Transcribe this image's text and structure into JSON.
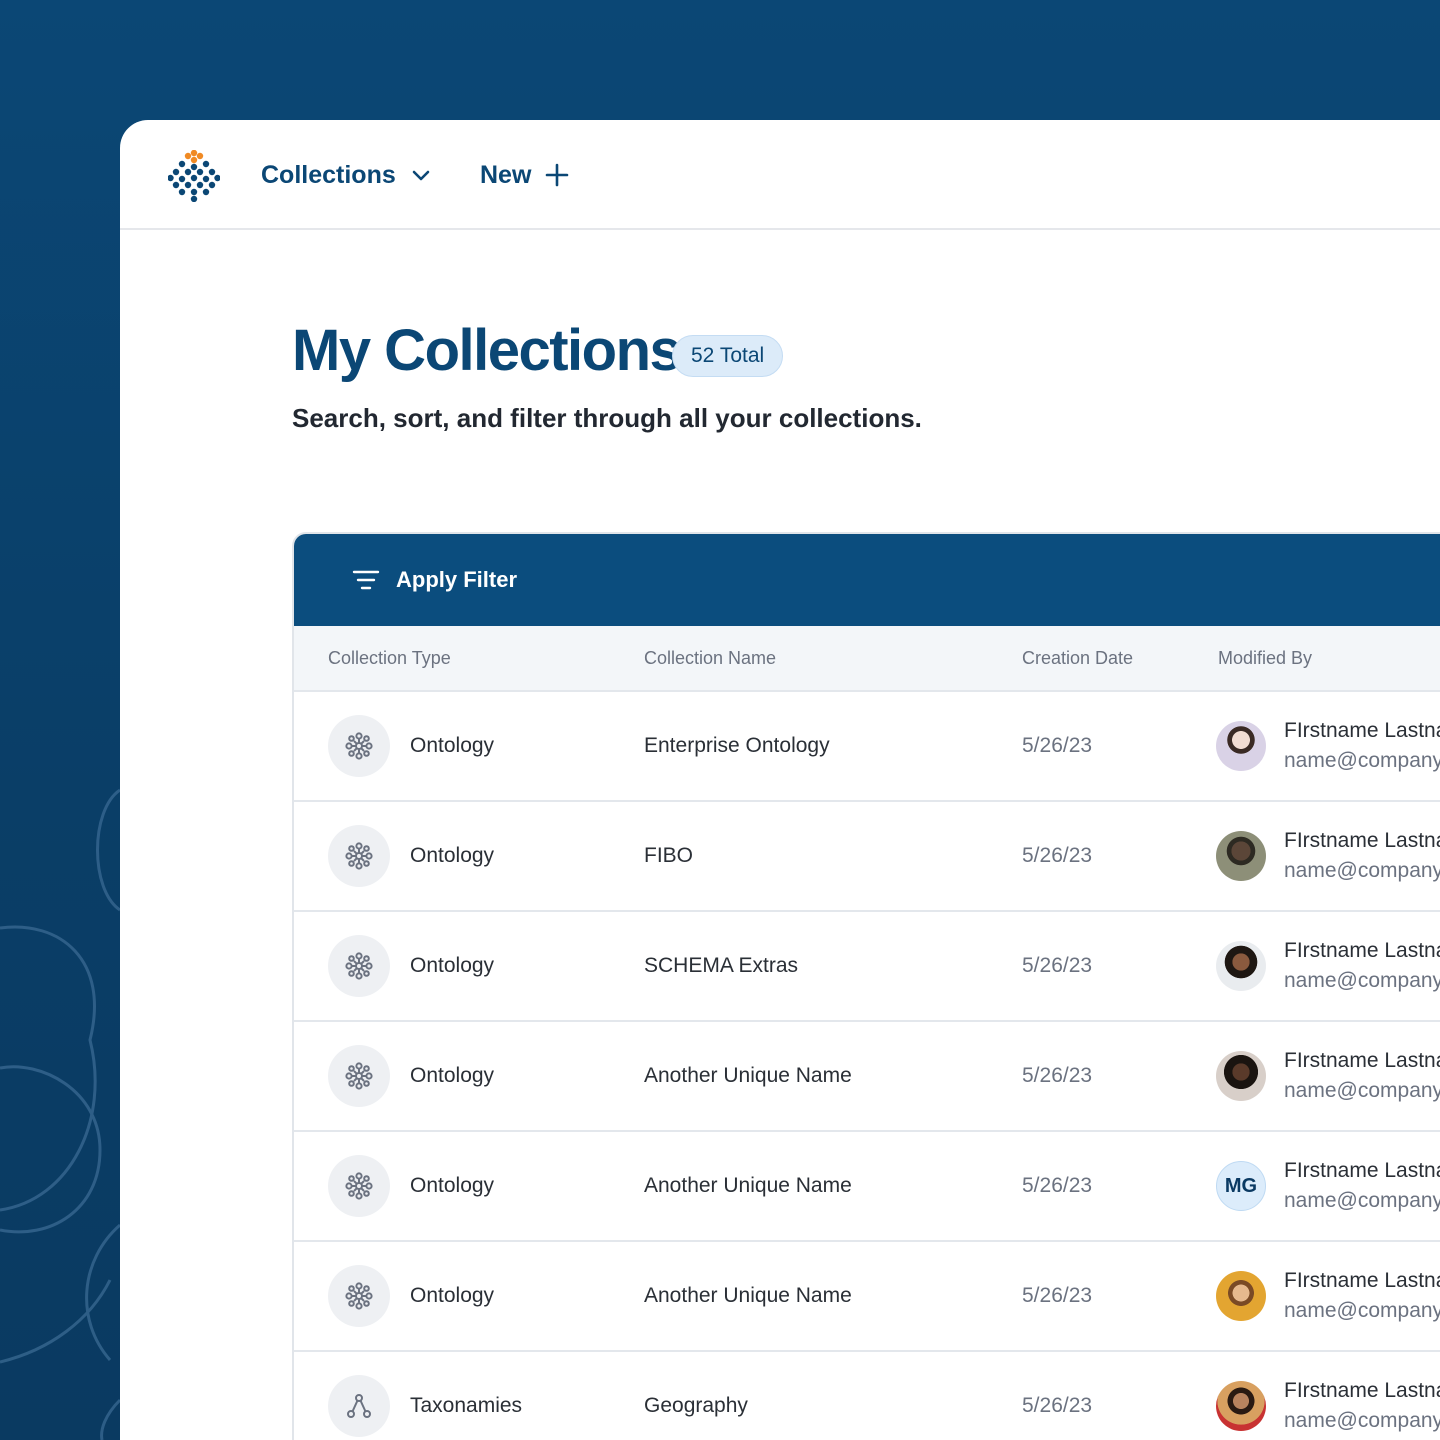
{
  "nav": {
    "collections_label": "Collections",
    "new_label": "New"
  },
  "header": {
    "title": "My Collections",
    "total_badge": "52 Total",
    "subtitle": "Search, sort, and filter through all your collections."
  },
  "toolbar": {
    "filter_label": "Apply Filter"
  },
  "table": {
    "columns": [
      "Collection Type",
      "Collection Name",
      "Creation Date",
      "Modified By"
    ],
    "rows": [
      {
        "type": "Ontology",
        "type_icon": "network-node-icon",
        "name": "Enterprise Ontology",
        "date": "5/26/23",
        "modified_name": "FIrstname Lastname",
        "modified_email": "name@company.com",
        "avatar": "photo"
      },
      {
        "type": "Ontology",
        "type_icon": "network-node-icon",
        "name": "FIBO",
        "date": "5/26/23",
        "modified_name": "FIrstname Lastname",
        "modified_email": "name@company.com",
        "avatar": "photo"
      },
      {
        "type": "Ontology",
        "type_icon": "network-node-icon",
        "name": "SCHEMA Extras",
        "date": "5/26/23",
        "modified_name": "FIrstname Lastname",
        "modified_email": "name@company.com",
        "avatar": "photo"
      },
      {
        "type": "Ontology",
        "type_icon": "network-node-icon",
        "name": "Another Unique Name",
        "date": "5/26/23",
        "modified_name": "FIrstname Lastname",
        "modified_email": "name@company.com",
        "avatar": "photo"
      },
      {
        "type": "Ontology",
        "type_icon": "network-node-icon",
        "name": "Another Unique Name",
        "date": "5/26/23",
        "modified_name": "FIrstname Lastname",
        "modified_email": "name@company.com",
        "avatar": "initials",
        "initials": "MG"
      },
      {
        "type": "Ontology",
        "type_icon": "network-node-icon",
        "name": "Another Unique Name",
        "date": "5/26/23",
        "modified_name": "FIrstname Lastname",
        "modified_email": "name@company.com",
        "avatar": "photo"
      },
      {
        "type": "Taxonamies",
        "type_icon": "hierarchy-icon",
        "name": "Geography",
        "date": "5/26/23",
        "modified_name": "FIrstname Lastname",
        "modified_email": "name@company.com",
        "avatar": "photo"
      }
    ]
  },
  "colors": {
    "brand": "#0b4775",
    "accent": "#f08a24",
    "filter_bar": "#0b4d7e"
  }
}
